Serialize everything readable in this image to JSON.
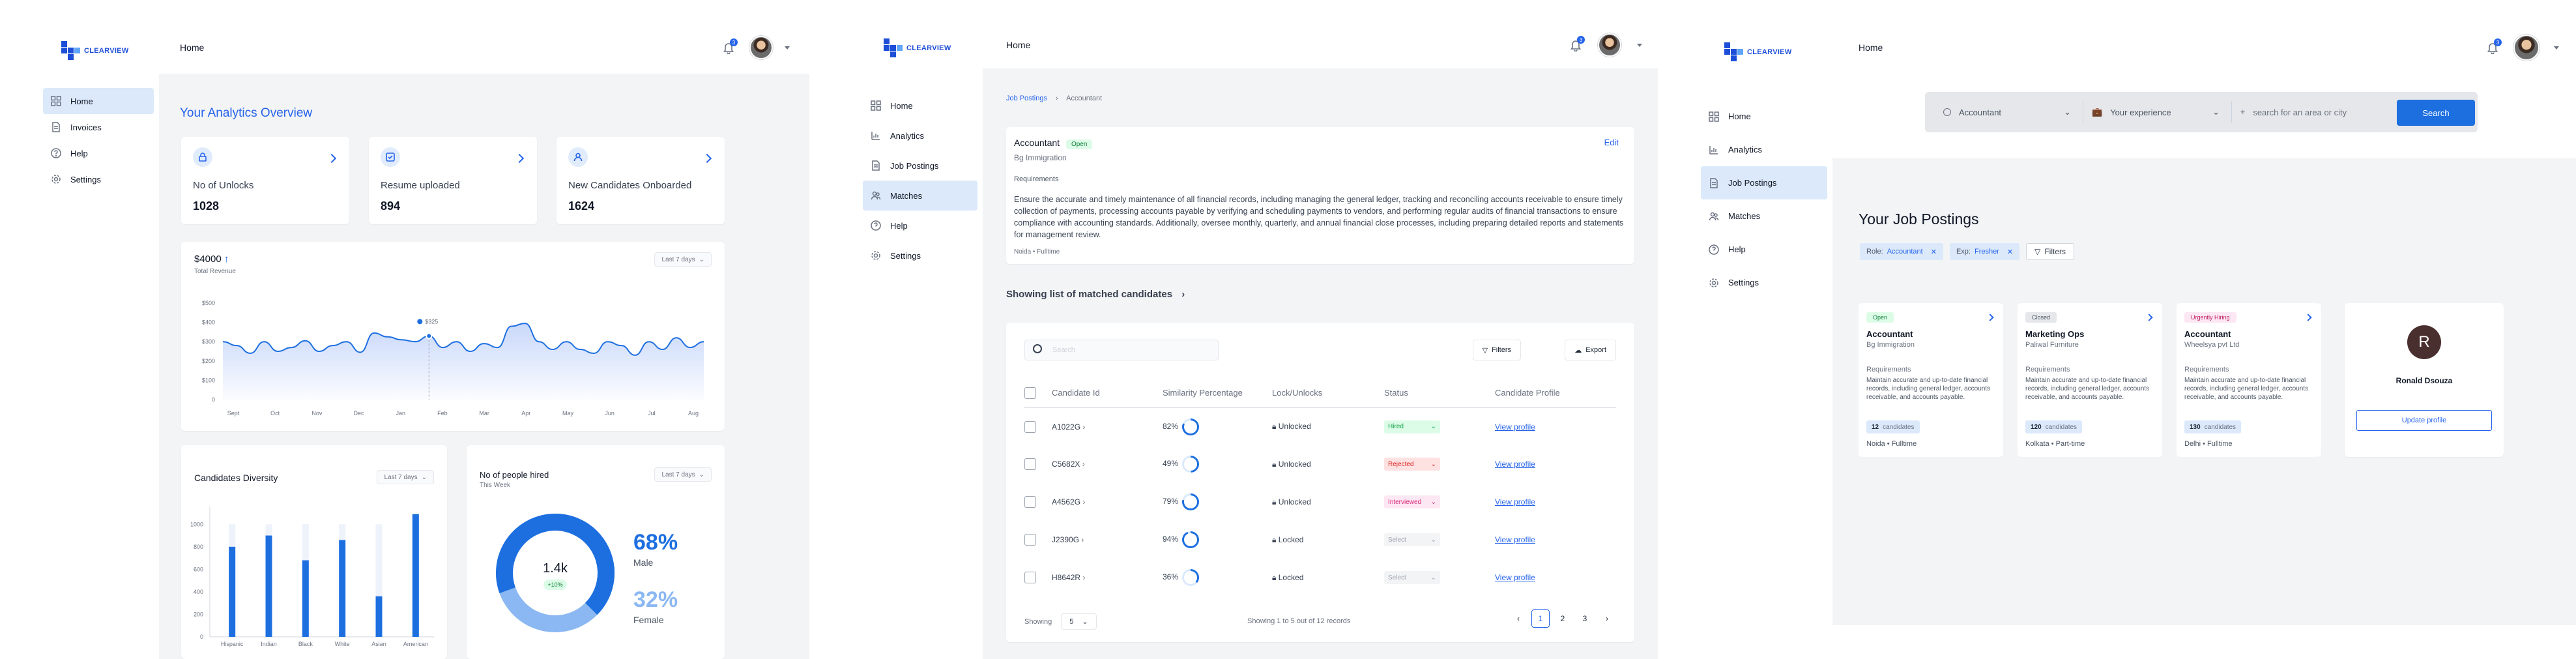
{
  "brand": {
    "name": "CLEARVIEW",
    "accent": "#2563eb"
  },
  "dashboard": {
    "page_title": "Home",
    "notif_count": "3",
    "nav": [
      {
        "label": "Home",
        "icon": "grid-icon",
        "active": true
      },
      {
        "label": "Invoices",
        "icon": "document-icon",
        "active": false
      },
      {
        "label": "Help",
        "icon": "help-icon",
        "active": false
      },
      {
        "label": "Settings",
        "icon": "gear-icon",
        "active": false
      }
    ],
    "overview_title": "Your Analytics Overview",
    "stats": [
      {
        "label": "No of Unlocks",
        "value": "1028",
        "icon": "lock-icon"
      },
      {
        "label": "Resume uploaded",
        "value": "894",
        "icon": "check-doc-icon"
      },
      {
        "label": "New Candidates Onboarded",
        "value": "1624",
        "icon": "user-icon"
      }
    ],
    "revenue": {
      "amount": "$4000",
      "caption": "Total Revenue",
      "range": "Last 7 days",
      "tooltip": "$325"
    },
    "diversity": {
      "title": "Candidates Diversity",
      "range": "Last 7 days"
    },
    "hired": {
      "title": "No of people hired",
      "subtitle": "This Week",
      "range": "Last 7 days",
      "center_value": "1.4k",
      "center_delta": "+10%",
      "male_pct": "68%",
      "male_label": "Male",
      "female_pct": "32%",
      "female_label": "Female",
      "male_share": 0.68
    }
  },
  "chart_data": [
    {
      "type": "area",
      "title": "Total Revenue",
      "x": [
        "Sept",
        "Oct",
        "Nov",
        "Dec",
        "Jan",
        "Feb",
        "Mar",
        "Apr",
        "May",
        "Jun",
        "Jul",
        "Aug"
      ],
      "y_ticks": [
        "$500",
        "$400",
        "$300",
        "$200",
        "$100",
        "0"
      ],
      "ylim": [
        0,
        500
      ],
      "values": [
        300,
        280,
        240,
        300,
        250,
        270,
        305,
        250,
        280,
        300,
        245,
        345,
        325,
        310,
        300,
        330,
        270,
        300,
        250,
        290,
        270,
        380,
        395,
        300,
        260,
        300,
        260,
        240,
        300,
        280,
        230,
        300,
        260,
        320,
        270,
        300
      ],
      "grid": false
    },
    {
      "type": "bar",
      "title": "Candidates Diversity",
      "categories": [
        "Hispanic",
        "Indian",
        "Black",
        "White",
        "Asian",
        "American"
      ],
      "y_ticks": [
        "1000",
        "800",
        "600",
        "400",
        "200",
        "0"
      ],
      "ylim": [
        0,
        1000
      ],
      "series": [
        {
          "values": [
            800,
            900,
            680,
            860,
            360,
            1090
          ]
        },
        {
          "values": [
            1000,
            1000,
            1000,
            1000,
            1000,
            1000
          ]
        }
      ]
    },
    {
      "type": "pie",
      "title": "No of people hired",
      "labels": [
        "Male",
        "Female"
      ],
      "values": [
        68,
        32
      ]
    }
  ],
  "matches": {
    "page_title": "Home",
    "notif_count": "3",
    "nav": [
      {
        "label": "Home",
        "icon": "grid-icon"
      },
      {
        "label": "Analytics",
        "icon": "chart-icon"
      },
      {
        "label": "Job Postings",
        "icon": "document-icon"
      },
      {
        "label": "Matches",
        "icon": "users-icon"
      },
      {
        "label": "Help",
        "icon": "help-icon"
      },
      {
        "label": "Settings",
        "icon": "gear-icon"
      }
    ],
    "breadcrumb": {
      "parent": "Job Postings",
      "current": "Accountant"
    },
    "job": {
      "title": "Accountant",
      "status": "Open",
      "company": "Bg Immigration",
      "edit": "Edit",
      "req_label": "Requirements",
      "description": "Ensure the accurate and timely maintenance of all financial records, including managing the general ledger, tracking and reconciling accounts receivable to ensure timely collection of payments, processing accounts payable by verifying and scheduling payments to vendors, and performing regular audits of financial transactions to ensure compliance with accounting standards. Additionally, oversee monthly, quarterly, and annual financial close processes, including preparing detailed reports and statements for management review.",
      "meta": "Noida • Fulltime"
    },
    "list_title": "Showing list of  matched candidates",
    "search_placeholder": "Search",
    "filters_label": "Filters",
    "export_label": "Export",
    "columns": [
      "Candidate Id",
      "Similarity Percentage",
      "Lock/Unlocks",
      "Status",
      "Candidate Profile"
    ],
    "rows": [
      {
        "id": "A1022G",
        "pct": "82%",
        "pct_val": 82,
        "lock": "Unlocked",
        "status": "Hired",
        "status_color": "#16a34a",
        "status_bg": "#dcfce7",
        "profile": "View profile"
      },
      {
        "id": "C5682X",
        "pct": "49%",
        "pct_val": 49,
        "lock": "Unlocked",
        "status": "Rejected",
        "status_color": "#dc2626",
        "status_bg": "#fee2e2",
        "profile": "View profile"
      },
      {
        "id": "A4562G",
        "pct": "79%",
        "pct_val": 79,
        "lock": "Unlocked",
        "status": "Interviewed",
        "status_color": "#db2777",
        "status_bg": "#fce7f3",
        "profile": "View profile"
      },
      {
        "id": "J2390G",
        "pct": "94%",
        "pct_val": 94,
        "lock": "Locked",
        "status": "Select",
        "status_color": "#9ca3af",
        "status_bg": "#f3f4f6",
        "profile": "View profile"
      },
      {
        "id": "H8642R",
        "pct": "36%",
        "pct_val": 36,
        "lock": "Locked",
        "status": "Select",
        "status_color": "#9ca3af",
        "status_bg": "#f3f4f6",
        "profile": "View profile"
      }
    ],
    "showing_label": "Showing",
    "page_size": "5",
    "records_text": "Showing 1 to 5 out of 12 records",
    "pages": [
      "1",
      "2",
      "3"
    ],
    "current_page": "1"
  },
  "postings": {
    "page_title": "Home",
    "notif_count": "3",
    "nav": [
      {
        "label": "Home",
        "icon": "grid-icon"
      },
      {
        "label": "Analytics",
        "icon": "chart-icon"
      },
      {
        "label": "Job Postings",
        "icon": "document-icon"
      },
      {
        "label": "Matches",
        "icon": "users-icon"
      },
      {
        "label": "Help",
        "icon": "help-icon"
      },
      {
        "label": "Settings",
        "icon": "gear-icon"
      }
    ],
    "search": {
      "role": "Accountant",
      "experience": "Your experience",
      "location_placeholder": "search for an area or city",
      "button": "Search"
    },
    "section_title": "Your Job Postings",
    "chips": [
      {
        "key": "Role:",
        "value": "Accountant"
      },
      {
        "key": "Exp:",
        "value": "Fresher"
      }
    ],
    "filters_label": "Filters",
    "cards": [
      {
        "badge": "Open",
        "badge_color": "#15803d",
        "badge_bg": "#dcfce7",
        "title": "Accountant",
        "company": "Bg Immigration",
        "req_label": "Requirements",
        "req": "Maintain accurate and up-to-date financial records, including general ledger, accounts receivable, and accounts payable.",
        "count": "12",
        "count_label": "candidates",
        "location": "Noida • Fulltime"
      },
      {
        "badge": "Closed",
        "badge_color": "#4b5563",
        "badge_bg": "#e5e7eb",
        "title": "Marketing Ops",
        "company": "Paliwal Furniture",
        "req_label": "Requirements",
        "req": "Maintain accurate and up-to-date financial records, including general ledger, accounts receivable, and accounts payable.",
        "count": "120",
        "count_label": "candidates",
        "location": "Kolkata • Part-time"
      },
      {
        "badge": "Urgently Hiring",
        "badge_color": "#be185d",
        "badge_bg": "#fce7f3",
        "title": "Accountant",
        "company": "Wheelsya pvt Ltd",
        "req_label": "Requirements",
        "req": "Maintain accurate and up-to-date financial records, including general ledger, accounts receivable, and accounts payable.",
        "count": "130",
        "count_label": "candidates",
        "location": "Delhi • Fulltime"
      }
    ],
    "profile": {
      "initial": "R",
      "name": "Ronald Dsouza",
      "button": "Update profile"
    }
  }
}
